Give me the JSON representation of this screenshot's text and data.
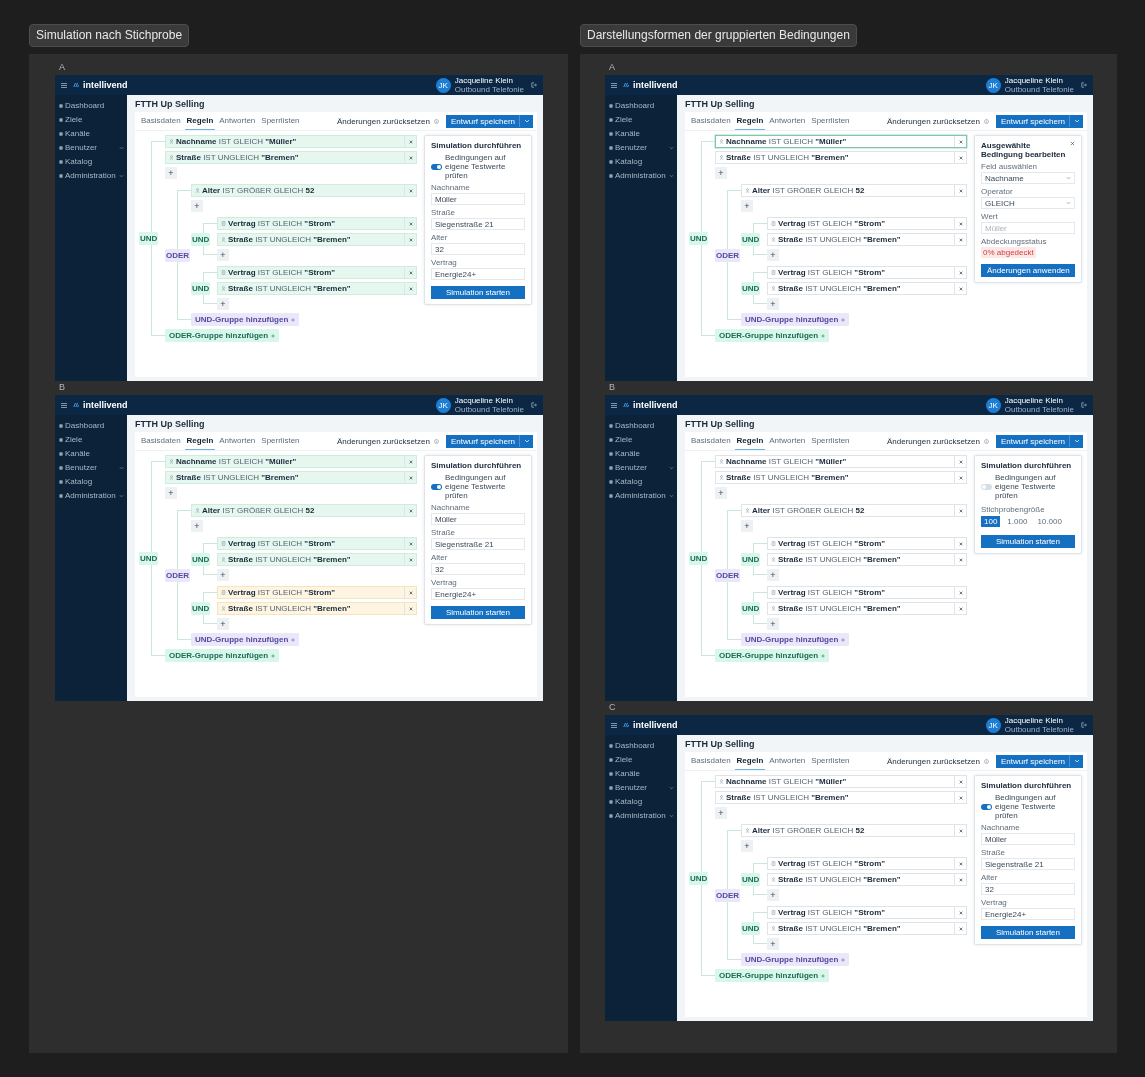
{
  "sections": [
    {
      "title": "Simulation nach Stichprobe",
      "frames": [
        {
          "label": "A",
          "brand": "intellivend",
          "user": {
            "initials": "JK",
            "name": "Jacqueline Klein",
            "role": "Outbound Telefonie"
          },
          "nav": [
            {
              "label": "Dashboard",
              "expandable": false
            },
            {
              "label": "Ziele",
              "expandable": false
            },
            {
              "label": "Kanäle",
              "expandable": false
            },
            {
              "label": "Benutzer",
              "expandable": true
            },
            {
              "label": "Katalog",
              "expandable": false
            },
            {
              "label": "Administration",
              "expandable": true
            }
          ],
          "page_title": "FTTH Up Selling",
          "tabs": [
            {
              "label": "Basisdaten",
              "selected": false
            },
            {
              "label": "Regeln",
              "selected": true
            },
            {
              "label": "Antworten",
              "selected": false
            },
            {
              "label": "Sperrlisten",
              "selected": false
            }
          ],
          "reset_link": "Änderungen zurücksetzen",
          "save_button": "Entwurf speichern",
          "rules": {
            "kind": "and",
            "operator": "UND",
            "conditions": [
              {
                "kind": "customer",
                "text": "**Nachname** IST GLEICH **\"Müller\"**",
                "matched": true
              },
              {
                "kind": "customer",
                "text": "**Straße** IST UNGLEICH **\"Bremen\"**",
                "matched": true
              }
            ],
            "add": "+",
            "groups": [
              {
                "kind": "or",
                "operator": "ODER",
                "conditions": [
                  {
                    "kind": "customer",
                    "text": "**Alter** IST GRÖßER GLEICH **52**",
                    "matched": true
                  }
                ],
                "add": "+",
                "groups": [
                  {
                    "kind": "and",
                    "operator": "UND",
                    "conditions": [
                      {
                        "kind": "contract",
                        "text": "**Vertrag** IST GLEICH **\"Strom\"**",
                        "matched": true
                      },
                      {
                        "kind": "customer",
                        "text": "**Straße** IST UNGLEICH **\"Bremen\"**",
                        "matched": true
                      }
                    ],
                    "add": "+"
                  },
                  {
                    "kind": "and",
                    "operator": "UND",
                    "conditions": [
                      {
                        "kind": "contract",
                        "text": "**Vertrag** IST GLEICH **\"Strom\"**",
                        "matched": true
                      },
                      {
                        "kind": "customer",
                        "text": "**Straße** IST UNGLEICH **\"Bremen\"**",
                        "matched": true
                      }
                    ],
                    "add": "+"
                  }
                ],
                "add_group": "UND-Gruppe hinzufügen"
              }
            ],
            "add_group": "ODER-Gruppe hinzufügen"
          },
          "panel": {
            "title": "Simulation durchführen",
            "items": [
              {
                "kind": "toggle",
                "label": "Bedingungen auf eigene Testwerte prüfen",
                "on": true
              },
              {
                "kind": "input",
                "label": "Nachname",
                "value": "Müller"
              },
              {
                "kind": "input",
                "label": "Straße",
                "value": "Siegenstraße 21"
              },
              {
                "kind": "input",
                "label": "Alter",
                "value": "32"
              },
              {
                "kind": "input",
                "label": "Vertrag",
                "value": "Energie24+"
              }
            ],
            "button": "Simulation starten"
          }
        },
        {
          "label": "B",
          "brand": "intellivend",
          "user": {
            "initials": "JK",
            "name": "Jacqueline Klein",
            "role": "Outbound Telefonie"
          },
          "nav": [
            {
              "label": "Dashboard",
              "expandable": false
            },
            {
              "label": "Ziele",
              "expandable": false
            },
            {
              "label": "Kanäle",
              "expandable": false
            },
            {
              "label": "Benutzer",
              "expandable": true
            },
            {
              "label": "Katalog",
              "expandable": false
            },
            {
              "label": "Administration",
              "expandable": true
            }
          ],
          "page_title": "FTTH Up Selling",
          "tabs": [
            {
              "label": "Basisdaten",
              "selected": false
            },
            {
              "label": "Regeln",
              "selected": true
            },
            {
              "label": "Antworten",
              "selected": false
            },
            {
              "label": "Sperrlisten",
              "selected": false
            }
          ],
          "reset_link": "Änderungen zurücksetzen",
          "save_button": "Entwurf speichern",
          "rules": {
            "kind": "and",
            "operator": "UND",
            "conditions": [
              {
                "kind": "customer",
                "text": "**Nachname** IST GLEICH **\"Müller\"**",
                "matched": true
              },
              {
                "kind": "customer",
                "text": "**Straße** IST UNGLEICH **\"Bremen\"**",
                "matched": true
              }
            ],
            "add": "+",
            "groups": [
              {
                "kind": "or",
                "operator": "ODER",
                "conditions": [
                  {
                    "kind": "customer",
                    "text": "**Alter** IST GRÖßER GLEICH **52**",
                    "matched": true
                  }
                ],
                "add": "+",
                "groups": [
                  {
                    "kind": "and",
                    "operator": "UND",
                    "conditions": [
                      {
                        "kind": "contract",
                        "text": "**Vertrag** IST GLEICH **\"Strom\"**",
                        "matched": true
                      },
                      {
                        "kind": "customer",
                        "text": "**Straße** IST UNGLEICH **\"Bremen\"**",
                        "matched": true
                      }
                    ],
                    "add": "+"
                  },
                  {
                    "kind": "and",
                    "operator": "UND",
                    "conditions": [
                      {
                        "kind": "contract",
                        "text": "**Vertrag** IST GLEICH **\"Strom\"**",
                        "matched": false
                      },
                      {
                        "kind": "customer",
                        "text": "**Straße** IST UNGLEICH **\"Bremen\"**",
                        "matched": false
                      }
                    ],
                    "add": "+"
                  }
                ],
                "add_group": "UND-Gruppe hinzufügen"
              }
            ],
            "add_group": "ODER-Gruppe hinzufügen"
          },
          "panel": {
            "title": "Simulation durchführen",
            "items": [
              {
                "kind": "toggle",
                "label": "Bedingungen auf eigene Testwerte prüfen",
                "on": true
              },
              {
                "kind": "input",
                "label": "Nachname",
                "value": "Müller"
              },
              {
                "kind": "input",
                "label": "Straße",
                "value": "Siegenstraße 21"
              },
              {
                "kind": "input",
                "label": "Alter",
                "value": "32"
              },
              {
                "kind": "input",
                "label": "Vertrag",
                "value": "Energie24+"
              }
            ],
            "button": "Simulation starten"
          }
        }
      ]
    },
    {
      "title": "Darstellungsformen der gruppierten Bedingungen",
      "frames": [
        {
          "label": "A",
          "brand": "intellivend",
          "user": {
            "initials": "JK",
            "name": "Jacqueline Klein",
            "role": "Outbound Telefonie"
          },
          "nav": [
            {
              "label": "Dashboard",
              "expandable": false
            },
            {
              "label": "Ziele",
              "expandable": false
            },
            {
              "label": "Kanäle",
              "expandable": false
            },
            {
              "label": "Benutzer",
              "expandable": true
            },
            {
              "label": "Katalog",
              "expandable": false
            },
            {
              "label": "Administration",
              "expandable": true
            }
          ],
          "page_title": "FTTH Up Selling",
          "tabs": [
            {
              "label": "Basisdaten",
              "selected": false
            },
            {
              "label": "Regeln",
              "selected": true
            },
            {
              "label": "Antworten",
              "selected": false
            },
            {
              "label": "Sperrlisten",
              "selected": false
            }
          ],
          "reset_link": "Änderungen zurücksetzen",
          "save_button": "Entwurf speichern",
          "rules": {
            "kind": "and",
            "operator": "UND",
            "conditions": [
              {
                "kind": "customer",
                "text": "**Nachname** IST GLEICH **\"Müller\"**",
                "selected": true
              },
              {
                "kind": "customer",
                "text": "**Straße** IST UNGLEICH **\"Bremen\"**",
                "selected": false
              }
            ],
            "add": "+",
            "groups": [
              {
                "kind": "or",
                "operator": "ODER",
                "conditions": [
                  {
                    "kind": "customer",
                    "text": "**Alter** IST GRÖßER GLEICH **52**",
                    "selected": false
                  }
                ],
                "add": "+",
                "groups": [
                  {
                    "kind": "and",
                    "operator": "UND",
                    "conditions": [
                      {
                        "kind": "contract",
                        "text": "**Vertrag** IST GLEICH **\"Strom\"**",
                        "selected": false
                      },
                      {
                        "kind": "customer",
                        "text": "**Straße** IST UNGLEICH **\"Bremen\"**",
                        "selected": false
                      }
                    ],
                    "add": "+"
                  },
                  {
                    "kind": "and",
                    "operator": "UND",
                    "conditions": [
                      {
                        "kind": "contract",
                        "text": "**Vertrag** IST GLEICH **\"Strom\"**",
                        "selected": false
                      },
                      {
                        "kind": "customer",
                        "text": "**Straße** IST UNGLEICH **\"Bremen\"**",
                        "selected": false
                      }
                    ],
                    "add": "+"
                  }
                ],
                "add_group": "UND-Gruppe hinzufügen"
              }
            ],
            "add_group": "ODER-Gruppe hinzufügen"
          },
          "panel": {
            "title": "Ausgewählte Bedingung bearbeiten",
            "closable": true,
            "items": [
              {
                "kind": "select",
                "label": "Feld auswählen",
                "value": "Nachname"
              },
              {
                "kind": "select",
                "label": "Operator",
                "value": "GLEICH"
              },
              {
                "kind": "input",
                "label": "Wert",
                "placeholder": "Müller"
              },
              {
                "kind": "status",
                "label": "Abdeckungsstatus",
                "value": "0% abgedeckt"
              }
            ],
            "button": "Änderungen anwenden"
          }
        },
        {
          "label": "B",
          "brand": "intellivend",
          "user": {
            "initials": "JK",
            "name": "Jacqueline Klein",
            "role": "Outbound Telefonie"
          },
          "nav": [
            {
              "label": "Dashboard",
              "expandable": false
            },
            {
              "label": "Ziele",
              "expandable": false
            },
            {
              "label": "Kanäle",
              "expandable": false
            },
            {
              "label": "Benutzer",
              "expandable": true
            },
            {
              "label": "Katalog",
              "expandable": false
            },
            {
              "label": "Administration",
              "expandable": true
            }
          ],
          "page_title": "FTTH Up Selling",
          "tabs": [
            {
              "label": "Basisdaten",
              "selected": false
            },
            {
              "label": "Regeln",
              "selected": true
            },
            {
              "label": "Antworten",
              "selected": false
            },
            {
              "label": "Sperrlisten",
              "selected": false
            }
          ],
          "reset_link": "Änderungen zurücksetzen",
          "save_button": "Entwurf speichern",
          "rules": {
            "kind": "and",
            "operator": "UND",
            "conditions": [
              {
                "kind": "customer",
                "text": "**Nachname** IST GLEICH **\"Müller\"**"
              },
              {
                "kind": "customer",
                "text": "**Straße** IST UNGLEICH **\"Bremen\"**"
              }
            ],
            "add": "+",
            "groups": [
              {
                "kind": "or",
                "operator": "ODER",
                "conditions": [
                  {
                    "kind": "customer",
                    "text": "**Alter** IST GRÖßER GLEICH **52**"
                  }
                ],
                "add": "+",
                "groups": [
                  {
                    "kind": "and",
                    "operator": "UND",
                    "conditions": [
                      {
                        "kind": "contract",
                        "text": "**Vertrag** IST GLEICH **\"Strom\"**"
                      },
                      {
                        "kind": "customer",
                        "text": "**Straße** IST UNGLEICH **\"Bremen\"**"
                      }
                    ],
                    "add": "+"
                  },
                  {
                    "kind": "and",
                    "operator": "UND",
                    "conditions": [
                      {
                        "kind": "contract",
                        "text": "**Vertrag** IST GLEICH **\"Strom\"**"
                      },
                      {
                        "kind": "customer",
                        "text": "**Straße** IST UNGLEICH **\"Bremen\"**"
                      }
                    ],
                    "add": "+"
                  }
                ],
                "add_group": "UND-Gruppe hinzufügen"
              }
            ],
            "add_group": "ODER-Gruppe hinzufügen"
          },
          "panel": {
            "title": "Simulation durchführen",
            "items": [
              {
                "kind": "toggle",
                "label": "Bedingungen auf eigene Testwerte prüfen",
                "on": false
              },
              {
                "kind": "segmented",
                "label": "Stichprobengröße",
                "options": [
                  {
                    "label": "100",
                    "selected": true
                  },
                  {
                    "label": "1.000",
                    "selected": false
                  },
                  {
                    "label": "10.000",
                    "selected": false
                  }
                ]
              }
            ],
            "button": "Simulation starten"
          }
        },
        {
          "label": "C",
          "brand": "intellivend",
          "user": {
            "initials": "JK",
            "name": "Jacqueline Klein",
            "role": "Outbound Telefonie"
          },
          "nav": [
            {
              "label": "Dashboard",
              "expandable": false
            },
            {
              "label": "Ziele",
              "expandable": false
            },
            {
              "label": "Kanäle",
              "expandable": false
            },
            {
              "label": "Benutzer",
              "expandable": true
            },
            {
              "label": "Katalog",
              "expandable": false
            },
            {
              "label": "Administration",
              "expandable": true
            }
          ],
          "page_title": "FTTH Up Selling",
          "tabs": [
            {
              "label": "Basisdaten",
              "selected": false
            },
            {
              "label": "Regeln",
              "selected": true
            },
            {
              "label": "Antworten",
              "selected": false
            },
            {
              "label": "Sperrlisten",
              "selected": false
            }
          ],
          "reset_link": "Änderungen zurücksetzen",
          "save_button": "Entwurf speichern",
          "rules": {
            "kind": "and",
            "operator": "UND",
            "conditions": [
              {
                "kind": "customer",
                "text": "**Nachname** IST GLEICH **\"Müller\"**"
              },
              {
                "kind": "customer",
                "text": "**Straße** IST UNGLEICH **\"Bremen\"**"
              }
            ],
            "add": "+",
            "groups": [
              {
                "kind": "or",
                "operator": "ODER",
                "conditions": [
                  {
                    "kind": "customer",
                    "text": "**Alter** IST GRÖßER GLEICH **52**"
                  }
                ],
                "add": "+",
                "groups": [
                  {
                    "kind": "and",
                    "operator": "UND",
                    "conditions": [
                      {
                        "kind": "contract",
                        "text": "**Vertrag** IST GLEICH **\"Strom\"**"
                      },
                      {
                        "kind": "customer",
                        "text": "**Straße** IST UNGLEICH **\"Bremen\"**"
                      }
                    ],
                    "add": "+"
                  },
                  {
                    "kind": "and",
                    "operator": "UND",
                    "conditions": [
                      {
                        "kind": "contract",
                        "text": "**Vertrag** IST GLEICH **\"Strom\"**"
                      },
                      {
                        "kind": "customer",
                        "text": "**Straße** IST UNGLEICH **\"Bremen\"**"
                      }
                    ],
                    "add": "+"
                  }
                ],
                "add_group": "UND-Gruppe hinzufügen"
              }
            ],
            "add_group": "ODER-Gruppe hinzufügen"
          },
          "panel": {
            "title": "Simulation durchführen",
            "items": [
              {
                "kind": "toggle",
                "label": "Bedingungen auf eigene Testwerte prüfen",
                "on": true
              },
              {
                "kind": "input",
                "label": "Nachname",
                "value": "Müller"
              },
              {
                "kind": "input",
                "label": "Straße",
                "value": "Siegenstraße 21"
              },
              {
                "kind": "input",
                "label": "Alter",
                "value": "32"
              },
              {
                "kind": "input",
                "label": "Vertrag",
                "value": "Energie24+"
              }
            ],
            "button": "Simulation starten"
          }
        }
      ]
    }
  ]
}
